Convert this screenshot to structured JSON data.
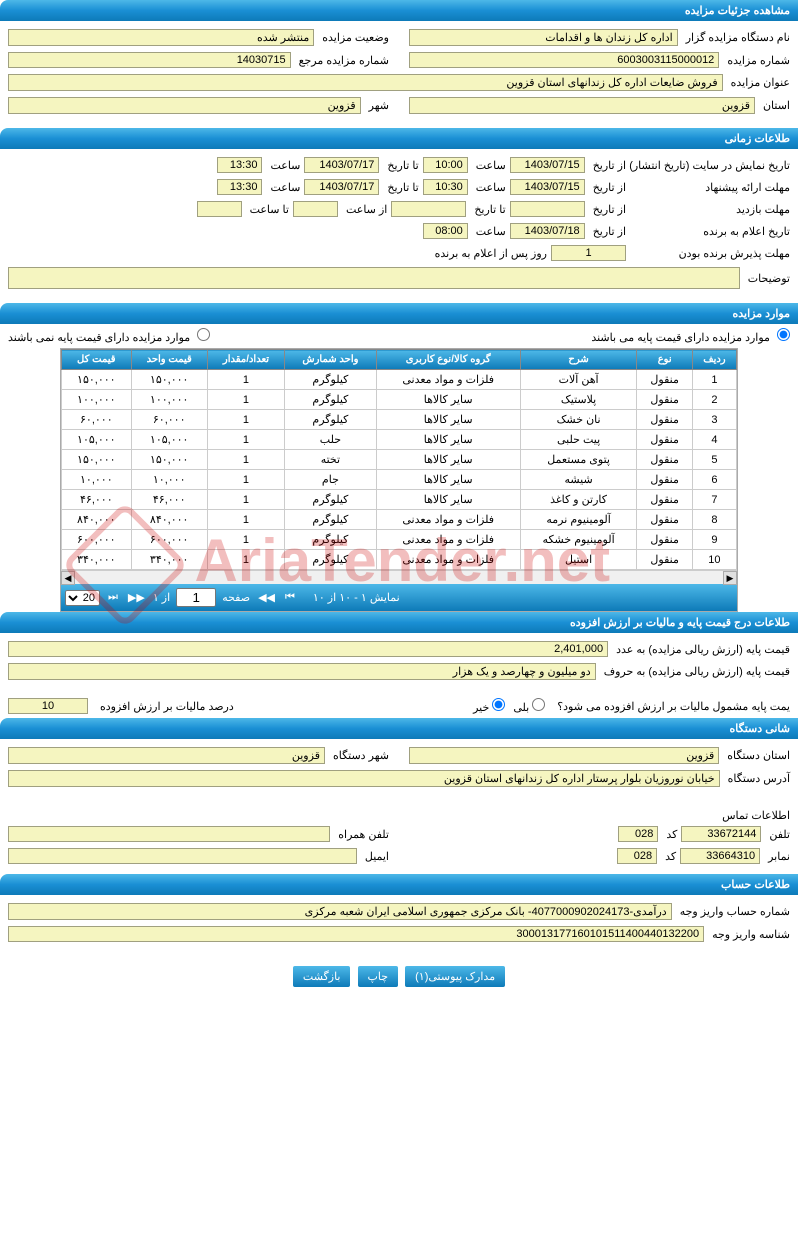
{
  "sections": {
    "details_title": "مشاهده جزئیات مزایده",
    "time_title": "طلاعات زمانی",
    "items_title": "موارد مزایده",
    "price_title": "طلاعات درج قیمت پایه و مالیات بر ارزش افزوده",
    "org_title": "شانی دستگاه",
    "account_title": "طلاعات حساب"
  },
  "details": {
    "holder_label": "نام دستگاه مزایده گزار",
    "holder_value": "اداره کل زندان ها و اقدامات",
    "status_label": "وضعیت مزایده",
    "status_value": "منتشر شده",
    "number_label": "شماره مزایده",
    "number_value": "6003003115000012",
    "ref_label": "شماره مزایده مرجع",
    "ref_value": "14030715",
    "title_label": "عنوان مزایده",
    "title_value": "فروش ضایعات اداره کل زندانهای استان قزوین",
    "province_label": "استان",
    "province_value": "قزوین",
    "city_label": "شهر",
    "city_value": "قزوین"
  },
  "time": {
    "publish_label": "تاریخ نمایش در سایت (تاریخ انتشار)",
    "from_label": "از تاریخ",
    "to_label": "تا تاریخ",
    "hour_label": "ساعت",
    "to_hour_label": "تا ساعت",
    "from_hour_label": "از ساعت",
    "publish_from_date": "1403/07/15",
    "publish_from_hour": "10:00",
    "publish_to_date": "1403/07/17",
    "publish_to_hour": "13:30",
    "propose_label": "مهلت ارائه پیشنهاد",
    "propose_from_date": "1403/07/15",
    "propose_from_hour": "10:30",
    "propose_to_date": "1403/07/17",
    "propose_to_hour": "13:30",
    "visit_label": "مهلت بازدید",
    "visit_from_date": "",
    "visit_to_date": "",
    "visit_from_hour": "",
    "visit_to_hour": "",
    "announce_label": "تاریخ اعلام به برنده",
    "announce_from_date": "1403/07/18",
    "announce_hour": "08:00",
    "accept_label": "مهلت پذیرش برنده بودن",
    "accept_value": "1",
    "accept_suffix": "روز پس از اعلام به برنده",
    "notes_label": "توضیحات",
    "notes_value": ""
  },
  "items": {
    "radio_has_base": "موارد مزایده دارای قیمت پایه می باشند",
    "radio_no_base": "موارد مزایده دارای قیمت پایه نمی باشند",
    "headers": {
      "row": "ردیف",
      "type": "نوع",
      "desc": "شرح",
      "group": "گروه کالا/نوع کاربری",
      "unit": "واحد شمارش",
      "qty": "تعداد/مقدار",
      "unit_price": "قیمت واحد",
      "total_price": "قیمت کل"
    },
    "rows": [
      {
        "n": "1",
        "type": "منقول",
        "desc": "آهن آلات",
        "group": "فلزات و مواد معدنی",
        "unit": "کیلوگرم",
        "qty": "1",
        "uprice": "۱۵۰,۰۰۰",
        "tprice": "۱۵۰,۰۰۰"
      },
      {
        "n": "2",
        "type": "منقول",
        "desc": "پلاستیک",
        "group": "سایر کالاها",
        "unit": "کیلوگرم",
        "qty": "1",
        "uprice": "۱۰۰,۰۰۰",
        "tprice": "۱۰۰,۰۰۰"
      },
      {
        "n": "3",
        "type": "منقول",
        "desc": "نان خشک",
        "group": "سایر کالاها",
        "unit": "کیلوگرم",
        "qty": "1",
        "uprice": "۶۰,۰۰۰",
        "tprice": "۶۰,۰۰۰"
      },
      {
        "n": "4",
        "type": "منقول",
        "desc": "پیت حلبی",
        "group": "سایر کالاها",
        "unit": "حلب",
        "qty": "1",
        "uprice": "۱۰۵,۰۰۰",
        "tprice": "۱۰۵,۰۰۰"
      },
      {
        "n": "5",
        "type": "منقول",
        "desc": "پتوی مستعمل",
        "group": "سایر کالاها",
        "unit": "تخته",
        "qty": "1",
        "uprice": "۱۵۰,۰۰۰",
        "tprice": "۱۵۰,۰۰۰"
      },
      {
        "n": "6",
        "type": "منقول",
        "desc": "شیشه",
        "group": "سایر کالاها",
        "unit": "جام",
        "qty": "1",
        "uprice": "۱۰,۰۰۰",
        "tprice": "۱۰,۰۰۰"
      },
      {
        "n": "7",
        "type": "منقول",
        "desc": "کارتن و کاغذ",
        "group": "سایر کالاها",
        "unit": "کیلوگرم",
        "qty": "1",
        "uprice": "۴۶,۰۰۰",
        "tprice": "۴۶,۰۰۰"
      },
      {
        "n": "8",
        "type": "منقول",
        "desc": "آلومینیوم نرمه",
        "group": "فلزات و مواد معدنی",
        "unit": "کیلوگرم",
        "qty": "1",
        "uprice": "۸۴۰,۰۰۰",
        "tprice": "۸۴۰,۰۰۰"
      },
      {
        "n": "9",
        "type": "منقول",
        "desc": "آلومینیوم خشکه",
        "group": "فلزات و مواد معدنی",
        "unit": "کیلوگرم",
        "qty": "1",
        "uprice": "۶۰۰,۰۰۰",
        "tprice": "۶۰۰,۰۰۰"
      },
      {
        "n": "10",
        "type": "منقول",
        "desc": "استیل",
        "group": "فلزات و مواد معدنی",
        "unit": "کیلوگرم",
        "qty": "1",
        "uprice": "۳۴۰,۰۰۰",
        "tprice": "۳۴۰,۰۰۰"
      }
    ],
    "pager": {
      "summary": "نمایش ۱ - ۱۰ از ۱۰",
      "page_label": "صفحه",
      "page_value": "1",
      "of_label": "از ۱",
      "perpage_value": "20"
    }
  },
  "price": {
    "base_num_label": "قیمت پایه (ارزش ریالی مزایده) به عدد",
    "base_num_value": "2,401,000",
    "base_text_label": "قیمت پایه (ارزش ریالی مزایده) به حروف",
    "base_text_value": "دو میلیون و چهارصد و یک هزار",
    "tax_question": "یمت پایه مشمول مالیات بر ارزش افزوده می شود؟",
    "yes": "بلی",
    "no": "خیر",
    "tax_percent_label": "درصد مالیات بر ارزش افزوده",
    "tax_percent_value": "10"
  },
  "org": {
    "province_label": "استان دستگاه",
    "province_value": "قزوین",
    "city_label": "شهر دستگاه",
    "city_value": "قزوین",
    "address_label": "آدرس دستگاه",
    "address_value": "خیابان نوروزیان بلوار پرستار اداره کل زندانهای استان قزوین",
    "contact_title": "اطلاعات تماس",
    "phone_label": "تلفن",
    "phone_value": "33672144",
    "code_label": "کد",
    "phone_code": "028",
    "mobile_label": "تلفن همراه",
    "mobile_value": "",
    "fax_label": "نمابر",
    "fax_value": "33664310",
    "fax_code": "028",
    "email_label": "ایمیل",
    "email_value": ""
  },
  "account": {
    "acc_label": "شماره حساب واریز وجه",
    "acc_value": "درآمدی-4077000902024173- بانک مرکزی جمهوری اسلامی ایران شعبه مرکزی",
    "id_label": "شناسه واریز وجه",
    "id_value": "300013177160101511400440132200"
  },
  "buttons": {
    "attach": "مدارک پیوستی(۱)",
    "print": "چاپ",
    "back": "بازگشت"
  },
  "watermark": "AriaTender.net"
}
